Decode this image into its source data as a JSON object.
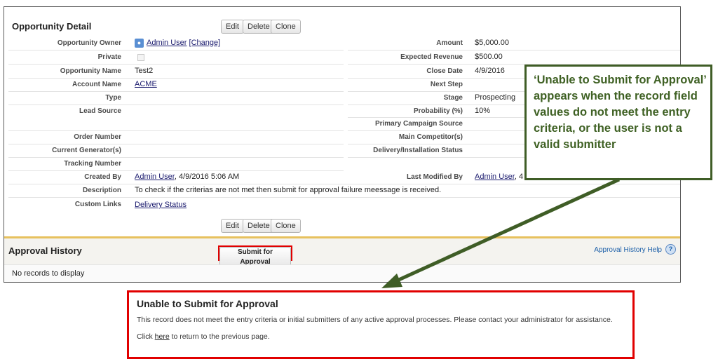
{
  "detail": {
    "title": "Opportunity Detail",
    "buttons": {
      "edit": "Edit",
      "delete": "Delete",
      "clone": "Clone"
    },
    "left_fields": {
      "owner_label": "Opportunity Owner",
      "owner_value": "Admin User",
      "owner_change": "[Change]",
      "private_label": "Private",
      "name_label": "Opportunity Name",
      "name_value": "Test2",
      "account_label": "Account Name",
      "account_value": "ACME",
      "type_label": "Type",
      "lead_source_label": "Lead Source",
      "order_label": "Order Number",
      "generator_label": "Current Generator(s)",
      "tracking_label": "Tracking Number",
      "created_label": "Created By",
      "created_user": "Admin User",
      "created_date": ", 4/9/2016 5:06 AM",
      "description_label": "Description",
      "description_value": "To check if the criterias are not met then submit for approval failure meessage is received.",
      "custom_links_label": "Custom Links",
      "custom_links_value": "Delivery Status"
    },
    "right_fields": {
      "amount_label": "Amount",
      "amount_value": "$5,000.00",
      "expected_label": "Expected Revenue",
      "expected_value": "$500.00",
      "close_label": "Close Date",
      "close_value": "4/9/2016",
      "next_step_label": "Next Step",
      "stage_label": "Stage",
      "stage_value": "Prospecting",
      "probability_label": "Probability (%)",
      "probability_value": "10%",
      "campaign_label": "Primary Campaign Source",
      "competitor_label": "Main Competitor(s)",
      "delivery_label": "Delivery/Installation Status",
      "modified_label": "Last Modified By",
      "modified_user": "Admin User",
      "modified_rest": ", 4"
    }
  },
  "approval": {
    "title": "Approval History",
    "submit_label": "Submit for Approval",
    "help_label": "Approval History Help",
    "help_icon": "?",
    "empty_text": "No records to display"
  },
  "callout": {
    "text": "‘Unable to Submit for Approval’ appears when the record field values do not meet the entry criteria, or the user is not a valid submitter"
  },
  "error": {
    "title": "Unable to Submit for Approval",
    "message": "This record does not meet the entry criteria or initial submitters of any active approval processes. Please contact your administrator for assistance.",
    "return_prefix": "Click ",
    "return_link": "here",
    "return_suffix": " to return to the previous page."
  },
  "colors": {
    "callout_border": "#3f5d26",
    "callout_text": "#3f6124",
    "highlight_red": "#e10000",
    "approval_accent": "#e7c15e"
  }
}
